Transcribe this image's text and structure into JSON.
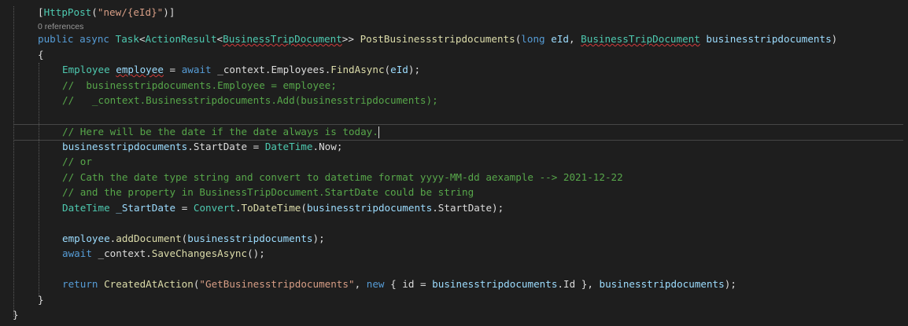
{
  "code_lens": {
    "references": "0 references"
  },
  "colors": {
    "background": "#1e1e1e",
    "keyword": "#569cd6",
    "type": "#4ec9b0",
    "method": "#dcdcaa",
    "parameter": "#9cdcfe",
    "string": "#d69d85",
    "comment": "#57a64a",
    "plain": "#dcdcdc"
  },
  "code": {
    "l1": {
      "a": "[",
      "b": "HttpPost",
      "c": "(",
      "d": "\"new/{eId}\"",
      "e": ")]"
    },
    "l2": {
      "a": "public",
      "b": "async",
      "c": "Task",
      "d": "<",
      "e": "ActionResult",
      "f": "<",
      "g": "BusinessTripDocument",
      "h": ">>",
      "i": "PostBusinessstripdocuments",
      "j": "(",
      "k": "long",
      "l": "eId",
      "m": ",",
      "n": "BusinessTripDocument",
      "o": "businesstripdocuments",
      "p": ")"
    },
    "l3": {
      "a": "{"
    },
    "l4": {
      "a": "Employee",
      "b": "employee",
      "c": "=",
      "d": "await",
      "e": "_context.Employees.",
      "f": "FindAsync",
      "g": "(",
      "h": "eId",
      "i": ");"
    },
    "l5": {
      "a": "//  businesstripdocuments.Employee = employee;"
    },
    "l6": {
      "a": "//   _context.Businesstripdocuments.Add(businesstripdocuments);"
    },
    "l7": {
      "a": "// Here will be the date if the date always is today."
    },
    "l8": {
      "a": "businesstripdocuments",
      "b": ".StartDate = ",
      "c": "DateTime",
      "d": ".Now;"
    },
    "l9": {
      "a": "// or"
    },
    "l10": {
      "a": "// Cath the date type string and convert to datetime format yyyy-MM-dd aexample --> 2021-12-22"
    },
    "l11": {
      "a": "// and the property in BusinessTripDocument.StartDate could be string"
    },
    "l12": {
      "a": "DateTime",
      "b": "_StartDate",
      "c": "=",
      "d": "Convert",
      "e": ".",
      "f": "ToDateTime",
      "g": "(",
      "h": "businesstripdocuments",
      "i": ".StartDate);"
    },
    "l13": {
      "a": "employee",
      "b": ".",
      "c": "addDocument",
      "d": "(",
      "e": "businesstripdocuments",
      "f": ");"
    },
    "l14": {
      "a": "await",
      "b": "_context.",
      "c": "SaveChangesAsync",
      "d": "();"
    },
    "l15": {
      "a": "return",
      "b": "CreatedAtAction",
      "c": "(",
      "d": "\"GetBusinesstripdocuments\"",
      "e": ",",
      "f": "new",
      "g": "{ id = ",
      "h": "businesstripdocuments",
      "i": ".Id },",
      "j": "businesstripdocuments",
      "k": ");"
    },
    "l16": {
      "a": "}"
    },
    "l17": {
      "a": "}"
    }
  }
}
